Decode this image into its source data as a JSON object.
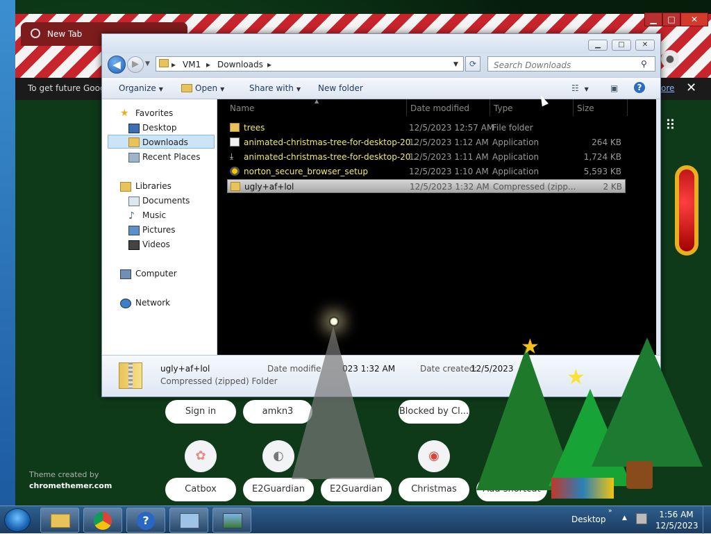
{
  "chrome": {
    "tab_title": "New Tab",
    "infobar_text": "To get future Goog",
    "infobar_more": "ore",
    "infobar_close": "✕",
    "apps_glyph": "⋮⋮⋮"
  },
  "explorer": {
    "breadcrumb": [
      "VM1",
      "Downloads"
    ],
    "search_placeholder": "Search Downloads",
    "toolbar": {
      "organize": "Organize",
      "open": "Open",
      "share_with": "Share with",
      "new_folder": "New folder"
    },
    "nav": {
      "favorites": "Favorites",
      "desktop": "Desktop",
      "downloads": "Downloads",
      "recent_places": "Recent Places",
      "libraries": "Libraries",
      "documents": "Documents",
      "music": "Music",
      "pictures": "Pictures",
      "videos": "Videos",
      "computer": "Computer",
      "network": "Network"
    },
    "columns": {
      "name": "Name",
      "date_modified": "Date modified",
      "type": "Type",
      "size": "Size"
    },
    "files": [
      {
        "name": "trees",
        "date": "12/5/2023 12:57 AM",
        "type": "File folder",
        "size": "",
        "icon": "folder-icon"
      },
      {
        "name": "animated-christmas-tree-for-desktop-20...",
        "date": "12/5/2023 1:12 AM",
        "type": "Application",
        "size": "264 KB",
        "icon": "application-icon"
      },
      {
        "name": "animated-christmas-tree-for-desktop-20...",
        "date": "12/5/2023 1:11 AM",
        "type": "Application",
        "size": "1,724 KB",
        "icon": "installer-icon"
      },
      {
        "name": "norton_secure_browser_setup",
        "date": "12/5/2023 1:10 AM",
        "type": "Application",
        "size": "5,593 KB",
        "icon": "norton-icon"
      },
      {
        "name": "ugly+af+lol",
        "date": "12/5/2023 1:32 AM",
        "type": "Compressed (zipp...",
        "size": "2 KB",
        "icon": "zip-folder-icon"
      }
    ],
    "details": {
      "name": "ugly+af+lol",
      "type": "Compressed (zipped) Folder",
      "date_modified_label": "Date modifie",
      "date_modified_value": "023 1:32 AM",
      "date_created_label": "Date created:",
      "date_created_value": "12/5/2023"
    }
  },
  "shortcuts": {
    "row1": [
      "Sign in",
      "amkn3",
      "Blocked by Cl..."
    ],
    "row2": [
      "Catbox",
      "E2Guardian",
      "E2Guardian",
      "Christmas",
      "Add shortcut"
    ]
  },
  "theme_credit": {
    "line1": "Theme created by",
    "line2": "chromethemer.com"
  },
  "taskbar": {
    "desktop_label": "Desktop",
    "time": "1:56 AM",
    "date": "12/5/2023"
  }
}
